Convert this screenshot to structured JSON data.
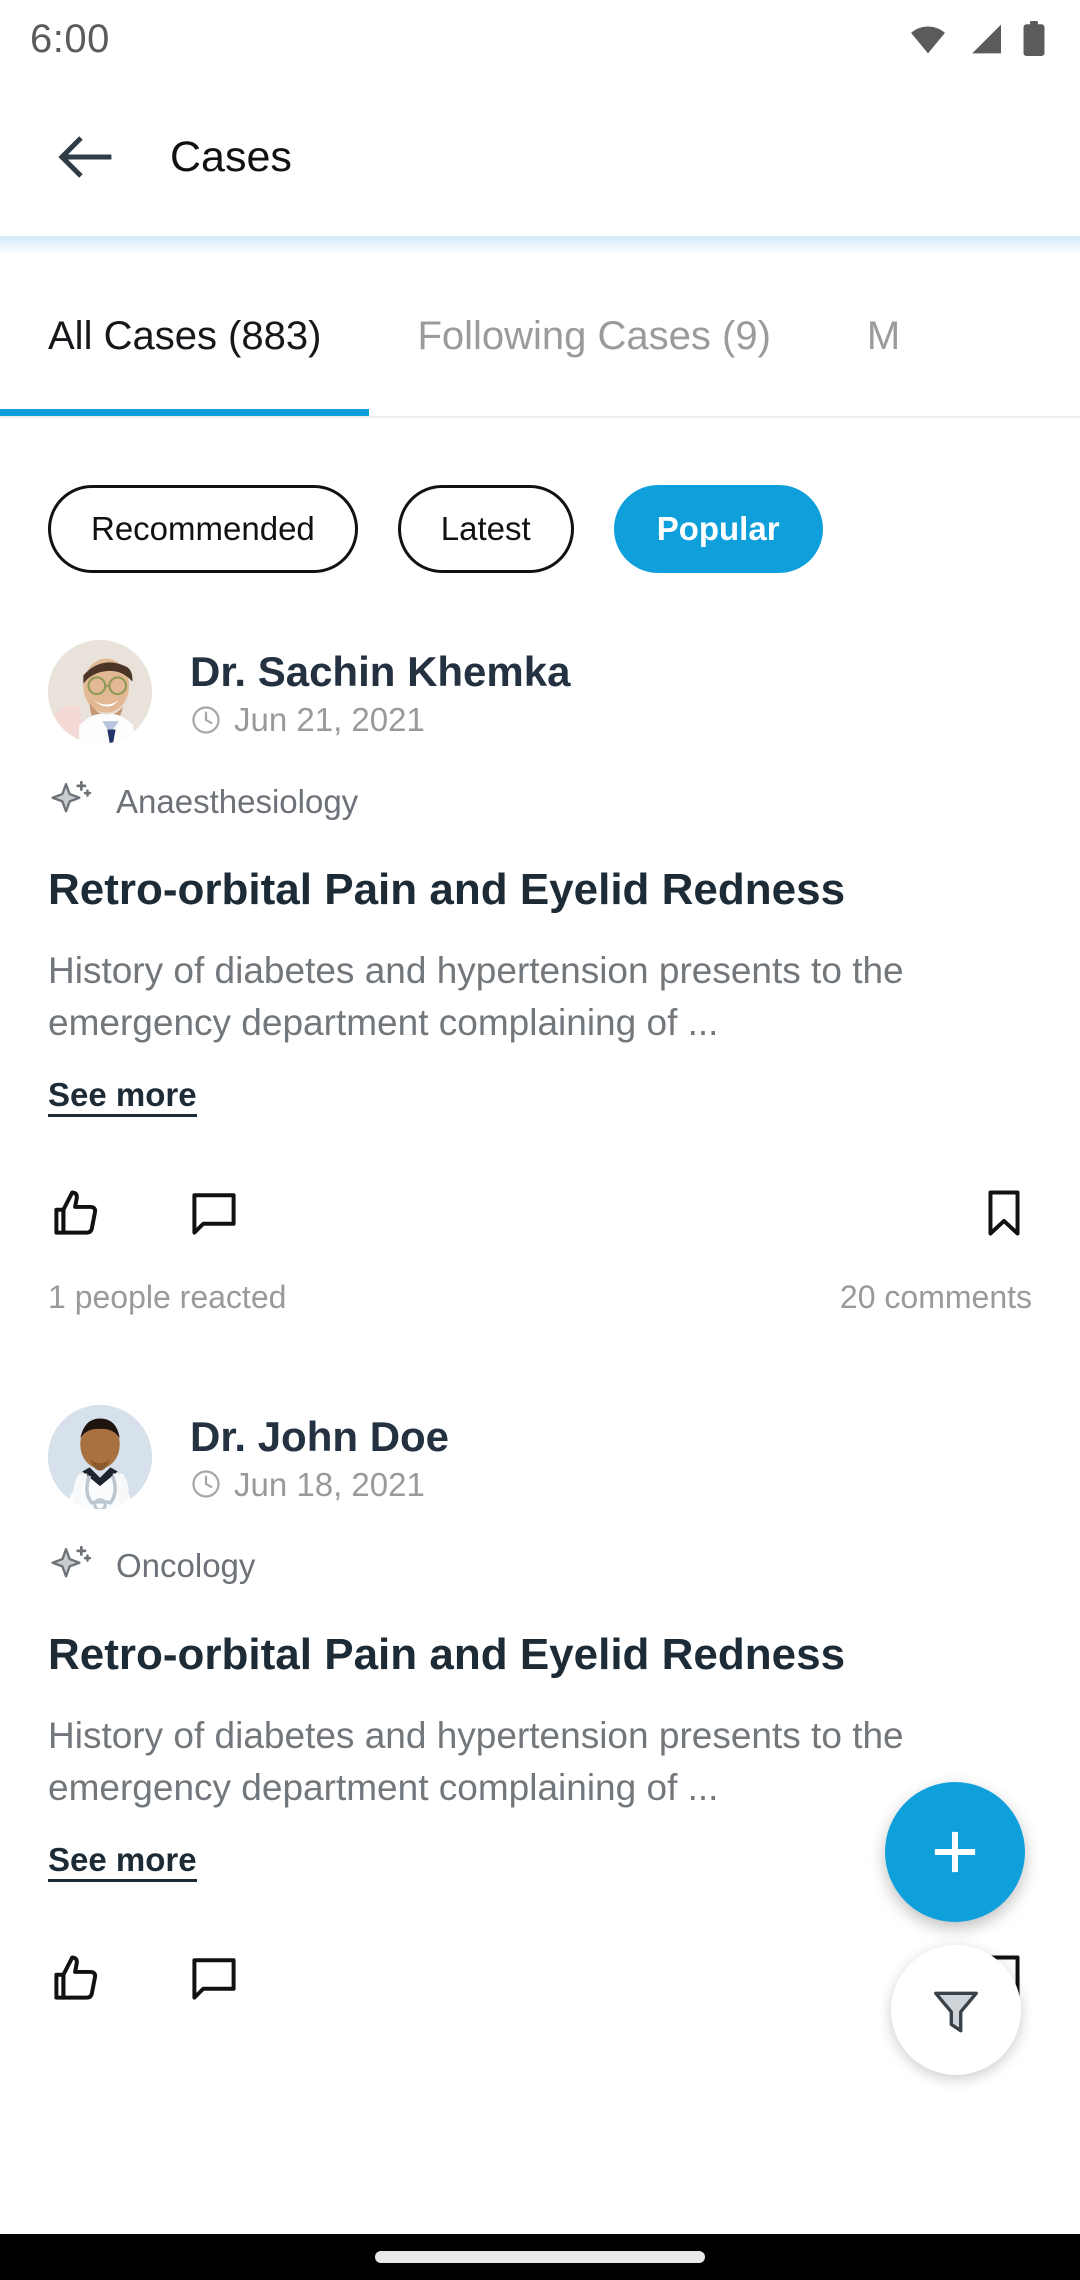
{
  "statusbar": {
    "time": "6:00",
    "icons": [
      "wifi-icon",
      "signal-icon",
      "battery-icon"
    ]
  },
  "appbar": {
    "back_icon": "back-arrow-icon",
    "title": "Cases"
  },
  "tabs": [
    {
      "label": "All Cases (883)",
      "active": true
    },
    {
      "label": "Following Cases (9)",
      "active": false
    },
    {
      "label": "M",
      "active": false
    }
  ],
  "chips": [
    {
      "label": "Recommended",
      "selected": false
    },
    {
      "label": "Latest",
      "selected": false
    },
    {
      "label": "Popular",
      "selected": true
    }
  ],
  "cards": [
    {
      "doctor": "Dr. Sachin Khemka",
      "date": "Jun 21, 2021",
      "clock_icon": "clock-icon",
      "specialty_icon": "sparkle-icon",
      "specialty": "Anaesthesiology",
      "title": "Retro-orbital Pain and Eyelid Redness",
      "body": "History of diabetes and hypertension presents to the emergency department complaining of ...",
      "see_more": "See more",
      "like_icon": "thumbs-up-icon",
      "comment_icon": "comment-icon",
      "bookmark_icon": "bookmark-icon",
      "reactions": "1 people reacted",
      "comments": "20 comments"
    },
    {
      "doctor": "Dr. John Doe",
      "date": "Jun 18, 2021",
      "clock_icon": "clock-icon",
      "specialty_icon": "sparkle-icon",
      "specialty": "Oncology",
      "title": "Retro-orbital Pain and Eyelid Redness",
      "body": "History of diabetes and hypertension presents to the emergency department complaining of ...",
      "see_more": "See more",
      "like_icon": "thumbs-up-icon",
      "comment_icon": "comment-icon",
      "bookmark_icon": "bookmark-icon",
      "reactions": "",
      "comments": ""
    }
  ],
  "fabs": {
    "add_icon": "plus-icon",
    "filter_icon": "filter-funnel-icon"
  },
  "colors": {
    "accent": "#0fa0dc",
    "title": "#1d2b36",
    "muted": "#9a9a9a",
    "body": "#72777c",
    "navbar": "#000000"
  }
}
